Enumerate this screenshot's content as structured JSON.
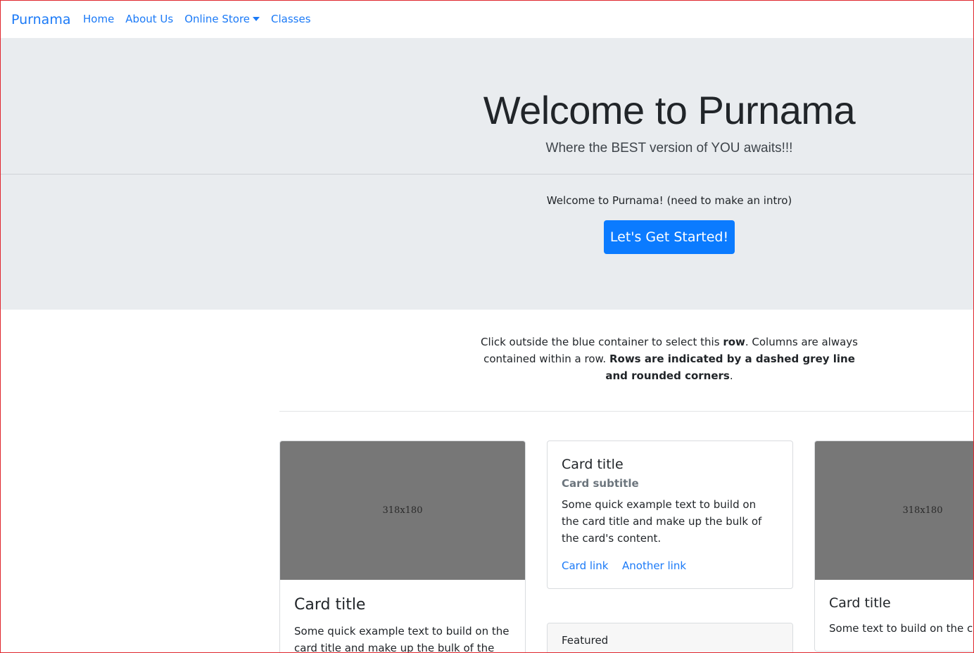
{
  "navbar": {
    "brand": "Purnama",
    "links": [
      {
        "label": "Home"
      },
      {
        "label": "About Us"
      },
      {
        "label": "Online Store"
      },
      {
        "label": "Classes"
      }
    ]
  },
  "jumbotron": {
    "title": "Welcome to Purnama",
    "lead": "Where the BEST version of YOU awaits!!!",
    "intro": "Welcome to Purnama! (need to make an intro)",
    "button": "Let's Get Started!"
  },
  "row_info": {
    "part1": "Click outside the blue container to select this ",
    "bold1": "row",
    "part2": ". Columns are always contained within a row. ",
    "bold2": "Rows are indicated by a dashed grey line and rounded corners",
    "part3": "."
  },
  "cards": {
    "left": {
      "image_label": "318x180",
      "title": "Card title",
      "text": "Some quick example text to build on the card title and make up the bulk of the card's content."
    },
    "middle": {
      "title": "Card title",
      "subtitle": "Card subtitle",
      "text": "Some quick example text to build on the card title and make up the bulk of the card's content.",
      "link1": "Card link",
      "link2": "Another link"
    },
    "featured": {
      "header": "Featured"
    },
    "right": {
      "image_label": "318x180",
      "title": "Card title",
      "text": "Some text to build on the card title"
    }
  },
  "colors": {
    "primary": "#0b7bff",
    "link": "#1b7af7",
    "jumbotron_bg": "#e9ecef",
    "placeholder_bg": "#777777"
  }
}
